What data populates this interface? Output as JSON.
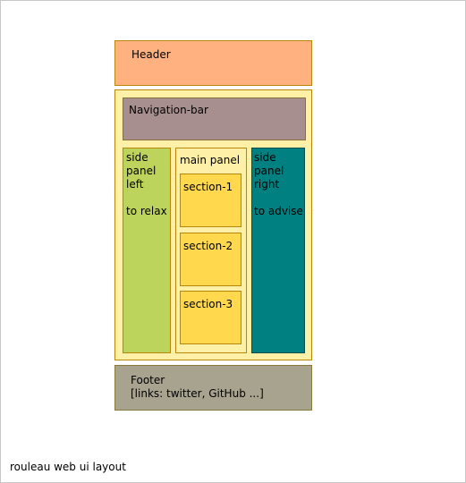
{
  "header": {
    "label": "Header"
  },
  "navbar": {
    "label": "Navigation-bar"
  },
  "left_panel": {
    "label": "side\npanel\nleft\n\nto relax"
  },
  "main_panel": {
    "label": "main panel",
    "sections": [
      "section-1",
      "section-2",
      "section-3"
    ]
  },
  "right_panel": {
    "label": "side\npanel\nright\n\nto advise"
  },
  "footer": {
    "label": "Footer\n[links: twitter, GitHub ...]"
  },
  "caption": "rouleau web ui layout",
  "colors": {
    "header": "#ffb27f",
    "container": "#fff0a8",
    "navbar": "#a88f8f",
    "left_panel": "#bdd45c",
    "main_panel": "#fff0a8",
    "section": "#ffd84d",
    "right_panel": "#008080",
    "footer": "#a8a38f"
  }
}
